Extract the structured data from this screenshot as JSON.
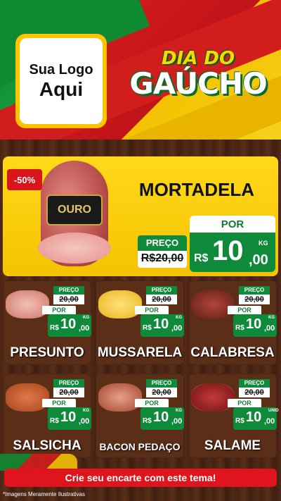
{
  "header": {
    "logo_line1": "Sua Logo",
    "logo_line2": "Aqui",
    "title_line1": "DIA DO",
    "title_line2": "GAÚCHO"
  },
  "featured": {
    "discount": "-50%",
    "brand": "OURO",
    "name": "MORTADELA",
    "preco_label": "PREÇO",
    "old_price": "R$20,00",
    "por_label": "POR",
    "currency": "R$",
    "price_int": "10",
    "price_dec": ",00",
    "unit": "KG"
  },
  "products": [
    {
      "name": "PRESUNTO",
      "preco_label": "PREÇO",
      "old_price": "20,00",
      "por_label": "POR",
      "currency": "R$",
      "price_int": "10",
      "price_dec": ",00",
      "unit": "KG"
    },
    {
      "name": "MUSSARELA",
      "preco_label": "PREÇO",
      "old_price": "20,00",
      "por_label": "POR",
      "currency": "R$",
      "price_int": "10",
      "price_dec": ",00",
      "unit": "KG"
    },
    {
      "name": "CALABRESA",
      "preco_label": "PREÇO",
      "old_price": "20,00",
      "por_label": "POR",
      "currency": "R$",
      "price_int": "10",
      "price_dec": ",00",
      "unit": "KG"
    },
    {
      "name": "SALSICHA",
      "preco_label": "PREÇO",
      "old_price": "20,00",
      "por_label": "POR",
      "currency": "R$",
      "price_int": "10",
      "price_dec": ",00",
      "unit": "KG"
    },
    {
      "name": "BACON PEDAÇO",
      "preco_label": "PREÇO",
      "old_price": "20,00",
      "por_label": "POR",
      "currency": "R$",
      "price_int": "10",
      "price_dec": ",00",
      "unit": "KG"
    },
    {
      "name": "SALAME",
      "preco_label": "PREÇO",
      "old_price": "20,00",
      "por_label": "POR",
      "currency": "R$",
      "price_int": "10",
      "price_dec": ",00",
      "unit": "UNID"
    }
  ],
  "cta": "Crie seu encarte com este tema!",
  "footnote": "*Imagens Meramente Ilustrativas",
  "colors": {
    "green": "#0f8a3a",
    "red": "#e0141c",
    "yellow": "#ffd91a",
    "wood": "#4a2614"
  }
}
